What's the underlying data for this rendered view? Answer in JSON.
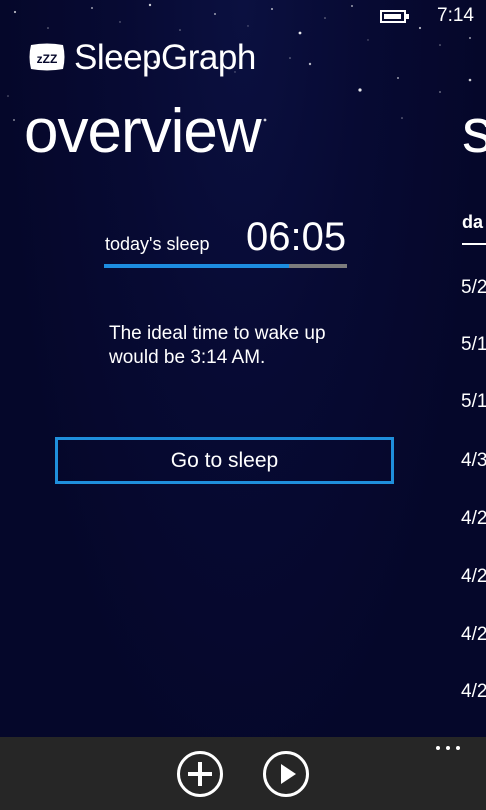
{
  "status_bar": {
    "time": "7:14",
    "battery_icon": "battery-icon"
  },
  "app": {
    "title": "SleepGraph",
    "logo_text": "zZZ"
  },
  "pivot": {
    "current": "overview",
    "next_peek": "s"
  },
  "overview": {
    "sleep_label": "today's sleep",
    "sleep_value": "06:05",
    "sleep_progress_fraction": 0.76,
    "wake_message": "The ideal time to wake up would be 3:14 AM.",
    "go_to_sleep_label": "Go to sleep"
  },
  "history_peek": {
    "header": "da",
    "items": [
      "5/2",
      "5/1",
      "5/1",
      "4/3",
      "4/2",
      "4/2",
      "4/2",
      "4/2"
    ]
  },
  "app_bar": {
    "buttons": [
      "add-icon",
      "play-icon"
    ],
    "more": "ellipsis-icon"
  },
  "colors": {
    "background": "#05072a",
    "accent": "#1d8de0",
    "progress_track": "#7c7c7c",
    "app_bar": "#262626"
  }
}
